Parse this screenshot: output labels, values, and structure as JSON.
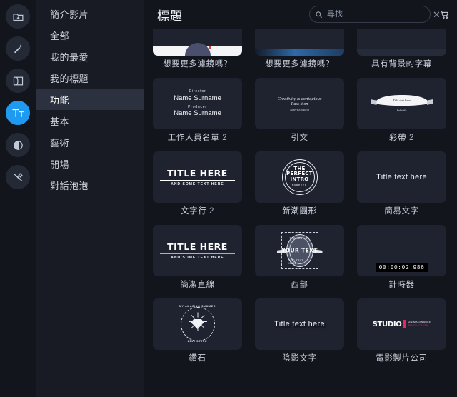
{
  "rail": {
    "items": [
      {
        "name": "media-library",
        "icon": "folder-plus-icon",
        "active": false
      },
      {
        "name": "effects",
        "icon": "magic-wand-icon",
        "active": false
      },
      {
        "name": "transitions",
        "icon": "transition-icon",
        "active": false
      },
      {
        "name": "titles",
        "icon": "title-text-icon",
        "active": true
      },
      {
        "name": "filters",
        "icon": "droplet-icon",
        "active": false
      },
      {
        "name": "tools",
        "icon": "tools-icon",
        "active": false
      }
    ]
  },
  "sidebar": {
    "items": [
      {
        "label": "簡介影片",
        "selected": false
      },
      {
        "label": "全部",
        "selected": false
      },
      {
        "label": "我的最愛",
        "selected": false
      },
      {
        "label": "我的標題",
        "selected": false
      },
      {
        "label": "功能",
        "selected": true
      },
      {
        "label": "基本",
        "selected": false
      },
      {
        "label": "藝術",
        "selected": false
      },
      {
        "label": "開場",
        "selected": false
      },
      {
        "label": "對話泡泡",
        "selected": false
      }
    ]
  },
  "header": {
    "title": "標題",
    "search": {
      "value": "",
      "placeholder": "尋找"
    },
    "clear_label": "✕",
    "cart_icon": "shopping-cart-icon"
  },
  "grid": {
    "items": [
      {
        "label": "想要更多濾鏡嗎？",
        "art": "band-white"
      },
      {
        "label": "想要更多濾鏡嗎？",
        "art": "band-blue"
      },
      {
        "label": "具有背景的字幕",
        "art": "band-plain"
      },
      {
        "label": "工作人員名單",
        "num": "2",
        "art": "credits",
        "credits": {
          "role1": "Director",
          "name1": "Name Surname",
          "role2": "Producer",
          "name2": "Name Surname"
        }
      },
      {
        "label": "引文",
        "art": "quote",
        "quote": {
          "line1": "Creativity is contagious",
          "line2": "Pass it on",
          "line3": "Albert Einstein"
        }
      },
      {
        "label": "彩帶",
        "num": "2",
        "art": "ribbon",
        "ribbon": {
          "title": "Title text here",
          "subtitle": "Subtitle"
        }
      },
      {
        "label": "文字行",
        "num": "2",
        "art": "titleline-white",
        "titleline": {
          "big": "TITLE HERE",
          "sub": "AND SOME TEXT HERE"
        }
      },
      {
        "label": "新潮圓形",
        "art": "circle-intro",
        "circle": {
          "l1": "THE",
          "l2": "PERFECT",
          "l3": "INTRO",
          "l4": "FOREVER"
        }
      },
      {
        "label": "簡易文字",
        "art": "simple-title",
        "simple": {
          "text": "Title text here"
        }
      },
      {
        "label": "簡潔直線",
        "art": "titleline-cyan",
        "titleline": {
          "big": "TITLE HERE",
          "sub": "AND SOME TEXT HERE"
        }
      },
      {
        "label": "西部",
        "art": "western",
        "western": {
          "top": "THE BEST OF",
          "center": "YOUR TEXT",
          "bottom": "ADD TEXT HERE"
        }
      },
      {
        "label": "計時器",
        "art": "timer",
        "timer": {
          "value": "00:00:02:986"
        }
      },
      {
        "label": "鑽石",
        "art": "diamond",
        "diamond": {
          "top": "MY AMAZING SUMMER",
          "bottom": "2019 STYLE"
        }
      },
      {
        "label": "陰影文字",
        "art": "shadow-title",
        "shadow": {
          "text": "Title text here"
        }
      },
      {
        "label": "電影製片公司",
        "art": "studio",
        "studio": {
          "word": "STUDIO",
          "line1": "UNIMAGINABLE",
          "line2": "PRODUCTION"
        }
      }
    ]
  },
  "colors": {
    "accent": "#1e9bf0",
    "panel_bg": "#12151c",
    "sidebar_bg": "#181b23",
    "card_bg": "#1f2330",
    "selected_bg": "#2c3140",
    "cyan_rule": "#38e3e0",
    "studio_pink": "#e8246b"
  }
}
